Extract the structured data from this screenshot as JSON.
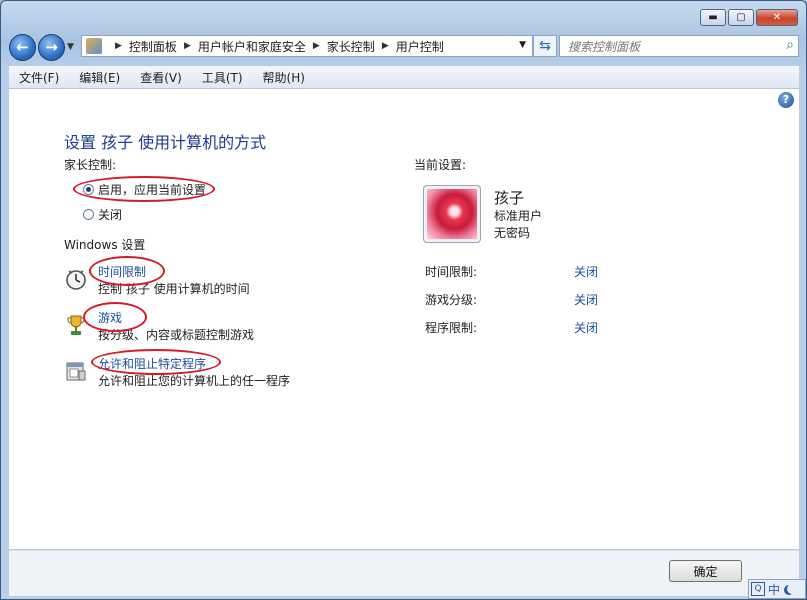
{
  "window": {
    "caption": {
      "minimize": "▬",
      "maximize": "▢",
      "close": "✕"
    }
  },
  "nav": {
    "back": "←",
    "forward": "→",
    "breadcrumbs": [
      "控制面板",
      "用户帐户和家庭安全",
      "家长控制",
      "用户控制"
    ],
    "search_placeholder": "搜索控制面板"
  },
  "menu": [
    "文件(F)",
    "编辑(E)",
    "查看(V)",
    "工具(T)",
    "帮助(H)"
  ],
  "main": {
    "title": "设置 孩子 使用计算机的方式",
    "parental_label": "家长控制:",
    "radio_on": "启用，应用当前设置",
    "radio_off": "关闭",
    "windows_label": "Windows 设置",
    "settings": [
      {
        "link": "时间限制",
        "desc": "控制 孩子 使用计算机的时间",
        "icon": "clock-icon"
      },
      {
        "link": "游戏",
        "desc": "按分级、内容或标题控制游戏",
        "icon": "trophy-icon"
      },
      {
        "link": "允许和阻止特定程序",
        "desc": "允许和阻止您的计算机上的任一程序",
        "icon": "program-icon"
      }
    ]
  },
  "current": {
    "label": "当前设置:",
    "user_name": "孩子",
    "user_type": "标准用户",
    "user_password": "无密码",
    "rows": [
      {
        "key": "时间限制:",
        "value": "关闭"
      },
      {
        "key": "游戏分级:",
        "value": "关闭"
      },
      {
        "key": "程序限制:",
        "value": "关闭"
      }
    ]
  },
  "footer": {
    "ok": "确定"
  },
  "ime": {
    "q": "Q",
    "lang": "中"
  },
  "colors": {
    "link": "#1a4fa0",
    "title": "#1e3c8c",
    "annotation": "#d41b2a"
  }
}
